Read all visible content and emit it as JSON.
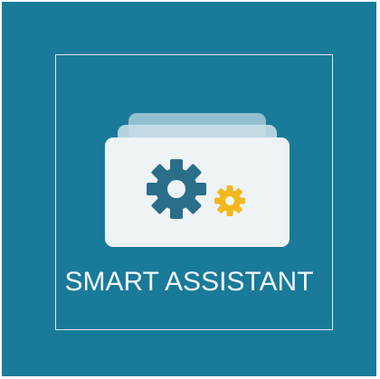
{
  "app": {
    "title": "SMART ASSISTANT"
  },
  "colors": {
    "background": "#1a7a9a",
    "frame": "#dcebf1",
    "card": "#eef3f5",
    "large_gear": "#2a6e8a",
    "small_gear": "#f2b81c",
    "text": "#f2f8fb"
  },
  "icons": {
    "large_gear": "gear-icon",
    "small_gear": "gear-icon",
    "stacked_cards": "cards-icon"
  }
}
